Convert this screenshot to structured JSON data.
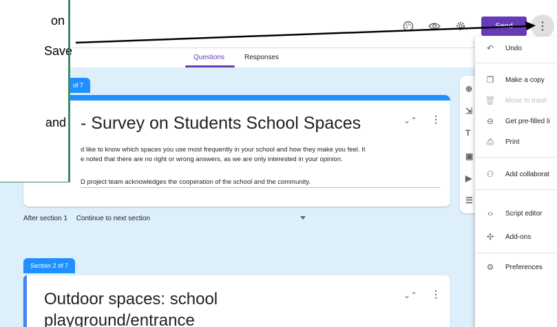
{
  "callout": {
    "lines": [
      "on",
      "Save",
      "and"
    ]
  },
  "toolbar": {
    "palette_icon": "palette-icon",
    "preview_icon": "eye-icon",
    "settings_icon": "gear-icon",
    "send_label": "Send",
    "more_icon": "more-vert-icon"
  },
  "tabs": [
    {
      "label": "Questions",
      "active": true
    },
    {
      "label": "Responses",
      "active": false
    }
  ],
  "section1": {
    "tag": "of 7",
    "title": "- Survey on Students School Spaces",
    "desc_line1": "d like to know which spaces you use most frequently in your school and how they make you feel. It",
    "desc_line2": "e noted that there are no right or wrong answers, as we are only interested in your opinion.",
    "desc_line3": "D project team acknowledges the cooperation of the school and the community."
  },
  "after_section": {
    "label": "After section 1",
    "value": "Continue to next section"
  },
  "section2": {
    "tag": "Section 2 of 7",
    "title_line1": "Outdoor spaces: school",
    "title_line2": "playground/entrance"
  },
  "menu": {
    "items": [
      {
        "label": "Undo",
        "icon": "undo-icon",
        "disabled": false
      },
      {
        "label": "Make a copy",
        "icon": "copy-icon",
        "disabled": false
      },
      {
        "label": "Move to trash",
        "icon": "trash-icon",
        "disabled": true
      },
      {
        "label": "Get pre-filled li",
        "icon": "link-icon",
        "disabled": false
      },
      {
        "label": "Print",
        "icon": "print-icon",
        "disabled": false
      },
      {
        "label": "Add collaborat",
        "icon": "add-people-icon",
        "disabled": false
      },
      {
        "label": "Script editor",
        "icon": "code-icon",
        "disabled": false
      },
      {
        "label": "Add-ons",
        "icon": "puzzle-icon",
        "disabled": false
      },
      {
        "label": "Preferences",
        "icon": "person-settings-icon",
        "disabled": false
      }
    ]
  },
  "colors": {
    "accent": "#673ab7",
    "section_blue": "#1e90ff",
    "canvas": "#ddeffb",
    "callout_border": "#3b8c6b"
  }
}
